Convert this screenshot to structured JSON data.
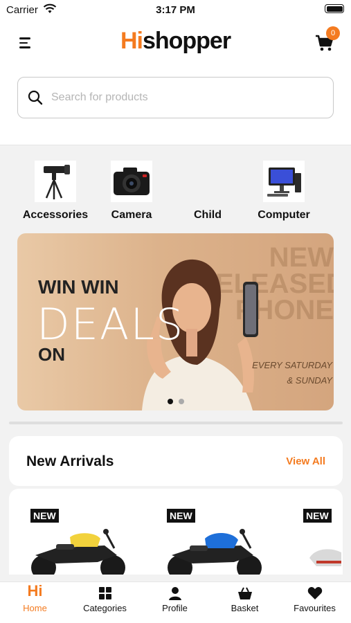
{
  "status_bar": {
    "carrier": "Carrier",
    "time": "3:17 PM"
  },
  "header": {
    "logo_hi": "Hi",
    "logo_rest": "shopper",
    "cart_count": "0"
  },
  "search": {
    "placeholder": "Search for products"
  },
  "categories": [
    {
      "label": "Accessories",
      "icon": "tripod-lens-icon"
    },
    {
      "label": "Camera",
      "icon": "camera-icon"
    },
    {
      "label": "Child",
      "icon": ""
    },
    {
      "label": "Computer",
      "icon": "computer-icon"
    }
  ],
  "banner": {
    "line1": "WIN WIN",
    "line2": "DEALS",
    "line3": "ON",
    "side_line1": "NEW",
    "side_line2": "RELEASED",
    "side_line3": "PHONE",
    "days_line1": "EVERY SATURDAY",
    "days_line2": "& SUNDAY",
    "active_slide": 1,
    "slide_count": 2
  },
  "arrivals": {
    "title": "New Arrivals",
    "view_all": "View All",
    "products": [
      {
        "badge": "NEW",
        "color": "#f2d23c"
      },
      {
        "badge": "NEW",
        "color": "#1e6fd9"
      },
      {
        "badge": "NEW",
        "color": "#d9d9d9"
      }
    ]
  },
  "tabs": [
    {
      "label": "Home",
      "icon": "hi-logo-icon",
      "active": true
    },
    {
      "label": "Categories",
      "icon": "grid-icon",
      "active": false
    },
    {
      "label": "Profile",
      "icon": "user-icon",
      "active": false
    },
    {
      "label": "Basket",
      "icon": "basket-icon",
      "active": false
    },
    {
      "label": "Favourites",
      "icon": "heart-icon",
      "active": false
    }
  ],
  "colors": {
    "accent": "#f47b20",
    "text": "#111111"
  }
}
